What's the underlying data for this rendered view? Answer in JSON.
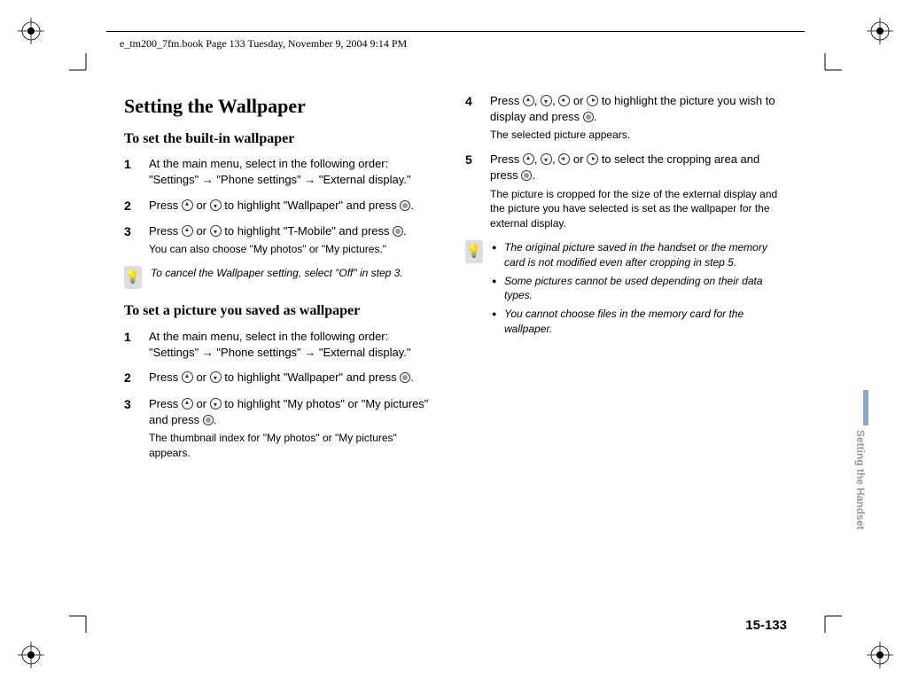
{
  "header": "e_tm200_7fm.book  Page 133  Tuesday, November 9, 2004  9:14 PM",
  "title": "Setting the Wallpaper",
  "sub1": "To set the built-in wallpaper",
  "left": {
    "s1": "At the main menu, select in the following order: \"Settings\" → \"Phone settings\" → \"External display.\"",
    "s2a": "Press ",
    "s2b": " or ",
    "s2c": " to highlight \"Wallpaper\" and press ",
    "s2d": ".",
    "s3a": "Press ",
    "s3b": " or ",
    "s3c": " to highlight \"T-Mobile\" and press ",
    "s3d": ".",
    "s3sub": "You can also choose \"My photos\" or \"My pictures.\"",
    "tip1": "To cancel the Wallpaper setting, select \"Off\" in step 3."
  },
  "sub2": "To set a picture you saved as wallpaper",
  "left2": {
    "s1": "At the main menu, select in the following order: \"Settings\" → \"Phone settings\" → \"External display.\"",
    "s2a": "Press ",
    "s2b": " or ",
    "s2c": " to highlight \"Wallpaper\" and press ",
    "s2d": ".",
    "s3a": "Press ",
    "s3b": " or ",
    "s3c": " to highlight \"My photos\" or \"My pictures\" and press ",
    "s3d": ".",
    "s3sub": "The thumbnail index for \"My photos\" or \"My pictures\" appears."
  },
  "right": {
    "s4a": "Press ",
    "s4b": ", ",
    "s4c": ", ",
    "s4d": " or ",
    "s4e": " to highlight the picture you wish to display and press ",
    "s4f": ".",
    "s4sub": "The selected picture appears.",
    "s5a": "Press ",
    "s5b": ", ",
    "s5c": ", ",
    "s5d": " or ",
    "s5e": " to select the cropping area and press ",
    "s5f": ".",
    "s5sub": "The picture is cropped for the size of the external display and the picture you have selected is set as the wallpaper for the external display.",
    "b1": "The original picture saved in the handset or the memory card is not modified even after cropping in step 5.",
    "b2": "Some pictures cannot be used depending on their data types.",
    "b3": "You cannot choose files in the memory card for the wallpaper."
  },
  "sidetab": "Setting the Handset",
  "pagenum": "15-133",
  "nums": {
    "n1": "1",
    "n2": "2",
    "n3": "3",
    "n4": "4",
    "n5": "5"
  }
}
